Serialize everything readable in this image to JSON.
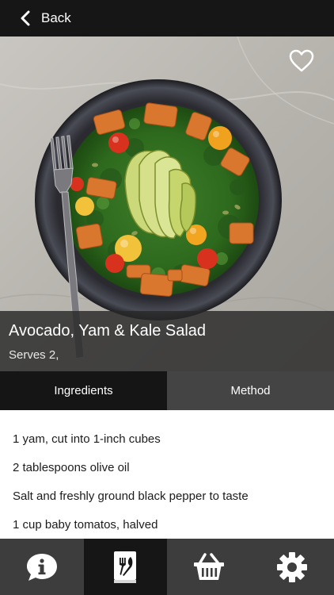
{
  "header": {
    "back_label": "Back"
  },
  "recipe": {
    "title": "Avocado, Yam & Kale Salad",
    "serves": "Serves 2,",
    "favorite_icon": "heart-outline-icon"
  },
  "tabs": [
    {
      "label": "Ingredients",
      "active": true
    },
    {
      "label": "Method",
      "active": false
    }
  ],
  "ingredients": [
    "1 yam, cut into 1-inch cubes",
    "2 tablespoons olive oil",
    "Salt and freshly ground black pepper to taste",
    "1 cup baby tomatos, halved"
  ],
  "bottom_nav": [
    {
      "icon": "info-bubble-icon",
      "active": false
    },
    {
      "icon": "recipe-book-icon",
      "active": true
    },
    {
      "icon": "shopping-basket-icon",
      "active": false
    },
    {
      "icon": "settings-gear-icon",
      "active": false
    }
  ],
  "colors": {
    "top_bar": "#161616",
    "tab_active": "#151515",
    "tab_inactive": "#444444",
    "bottom_bar": "#3d3d3d"
  }
}
